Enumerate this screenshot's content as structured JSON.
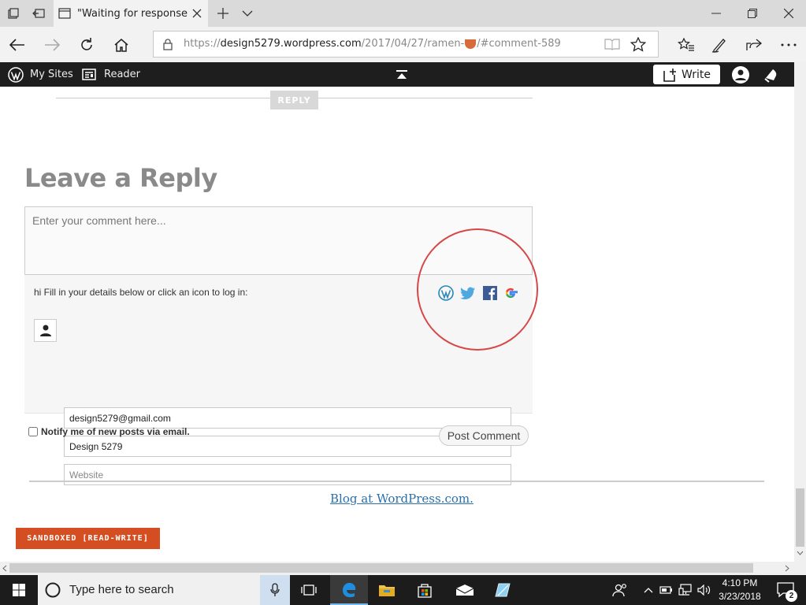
{
  "browser": {
    "tab_title": "\"Waiting for response fr",
    "url_prefix": "https://",
    "url_domain": "design5279.wordpress.com",
    "url_path": "/2017/04/27/ramen-",
    "url_suffix": "/#comment-589"
  },
  "wp_bar": {
    "my_sites": "My Sites",
    "reader": "Reader",
    "write": "Write"
  },
  "page": {
    "reply_button": "REPLY",
    "leave_reply_heading": "Leave a Reply",
    "comment_placeholder": "Enter your comment here...",
    "fill_in_text": "hi Fill in your details below or click an icon to log in:",
    "email_value": "design5279@gmail.com",
    "name_value": "Design 5279",
    "website_placeholder": "Website",
    "notify_label": "Notify me of new posts via email.",
    "post_comment_button": "Post Comment",
    "footer_link": "Blog at WordPress.com.",
    "sandbox_label": "SANDBOXED [READ-WRITE]",
    "social_icons": [
      "wordpress-icon",
      "twitter-icon",
      "facebook-icon",
      "google-icon"
    ],
    "colors": {
      "sandbox_bg": "#d54e21",
      "highlight_circle": "#d64747",
      "link": "#2a6fab",
      "wp_bar": "#1e1e1e"
    }
  },
  "taskbar": {
    "search_placeholder": "Type here to search",
    "time": "4:10 PM",
    "date": "3/23/2018",
    "notification_count": "2"
  }
}
